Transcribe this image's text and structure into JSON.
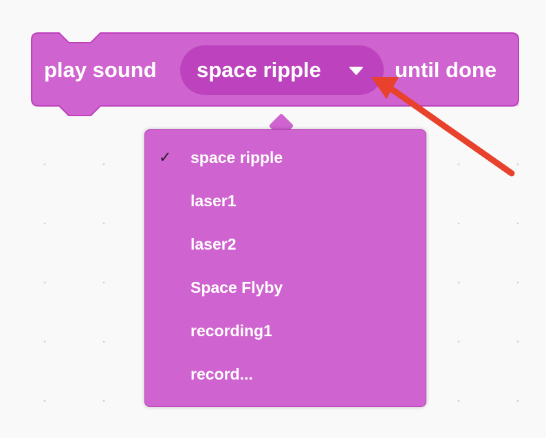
{
  "block": {
    "prefix_label": "play sound",
    "selected_sound": "space ripple",
    "suffix_label": "until done"
  },
  "colors": {
    "block_fill": "#cf63cf",
    "block_stroke": "#bd42bd",
    "dropdown_fill": "#bd42bd",
    "text": "#ffffff",
    "annotation_arrow": "#e8412c"
  },
  "icons": {
    "dropdown_caret": "caret-down-icon",
    "selected_marker": "checkmark-icon"
  },
  "menu": {
    "items": [
      {
        "label": "space ripple",
        "check": "✓"
      },
      {
        "label": "laser1",
        "check": ""
      },
      {
        "label": "laser2",
        "check": ""
      },
      {
        "label": "Space Flyby",
        "check": ""
      },
      {
        "label": "recording1",
        "check": ""
      },
      {
        "label": "record...",
        "check": ""
      }
    ]
  }
}
